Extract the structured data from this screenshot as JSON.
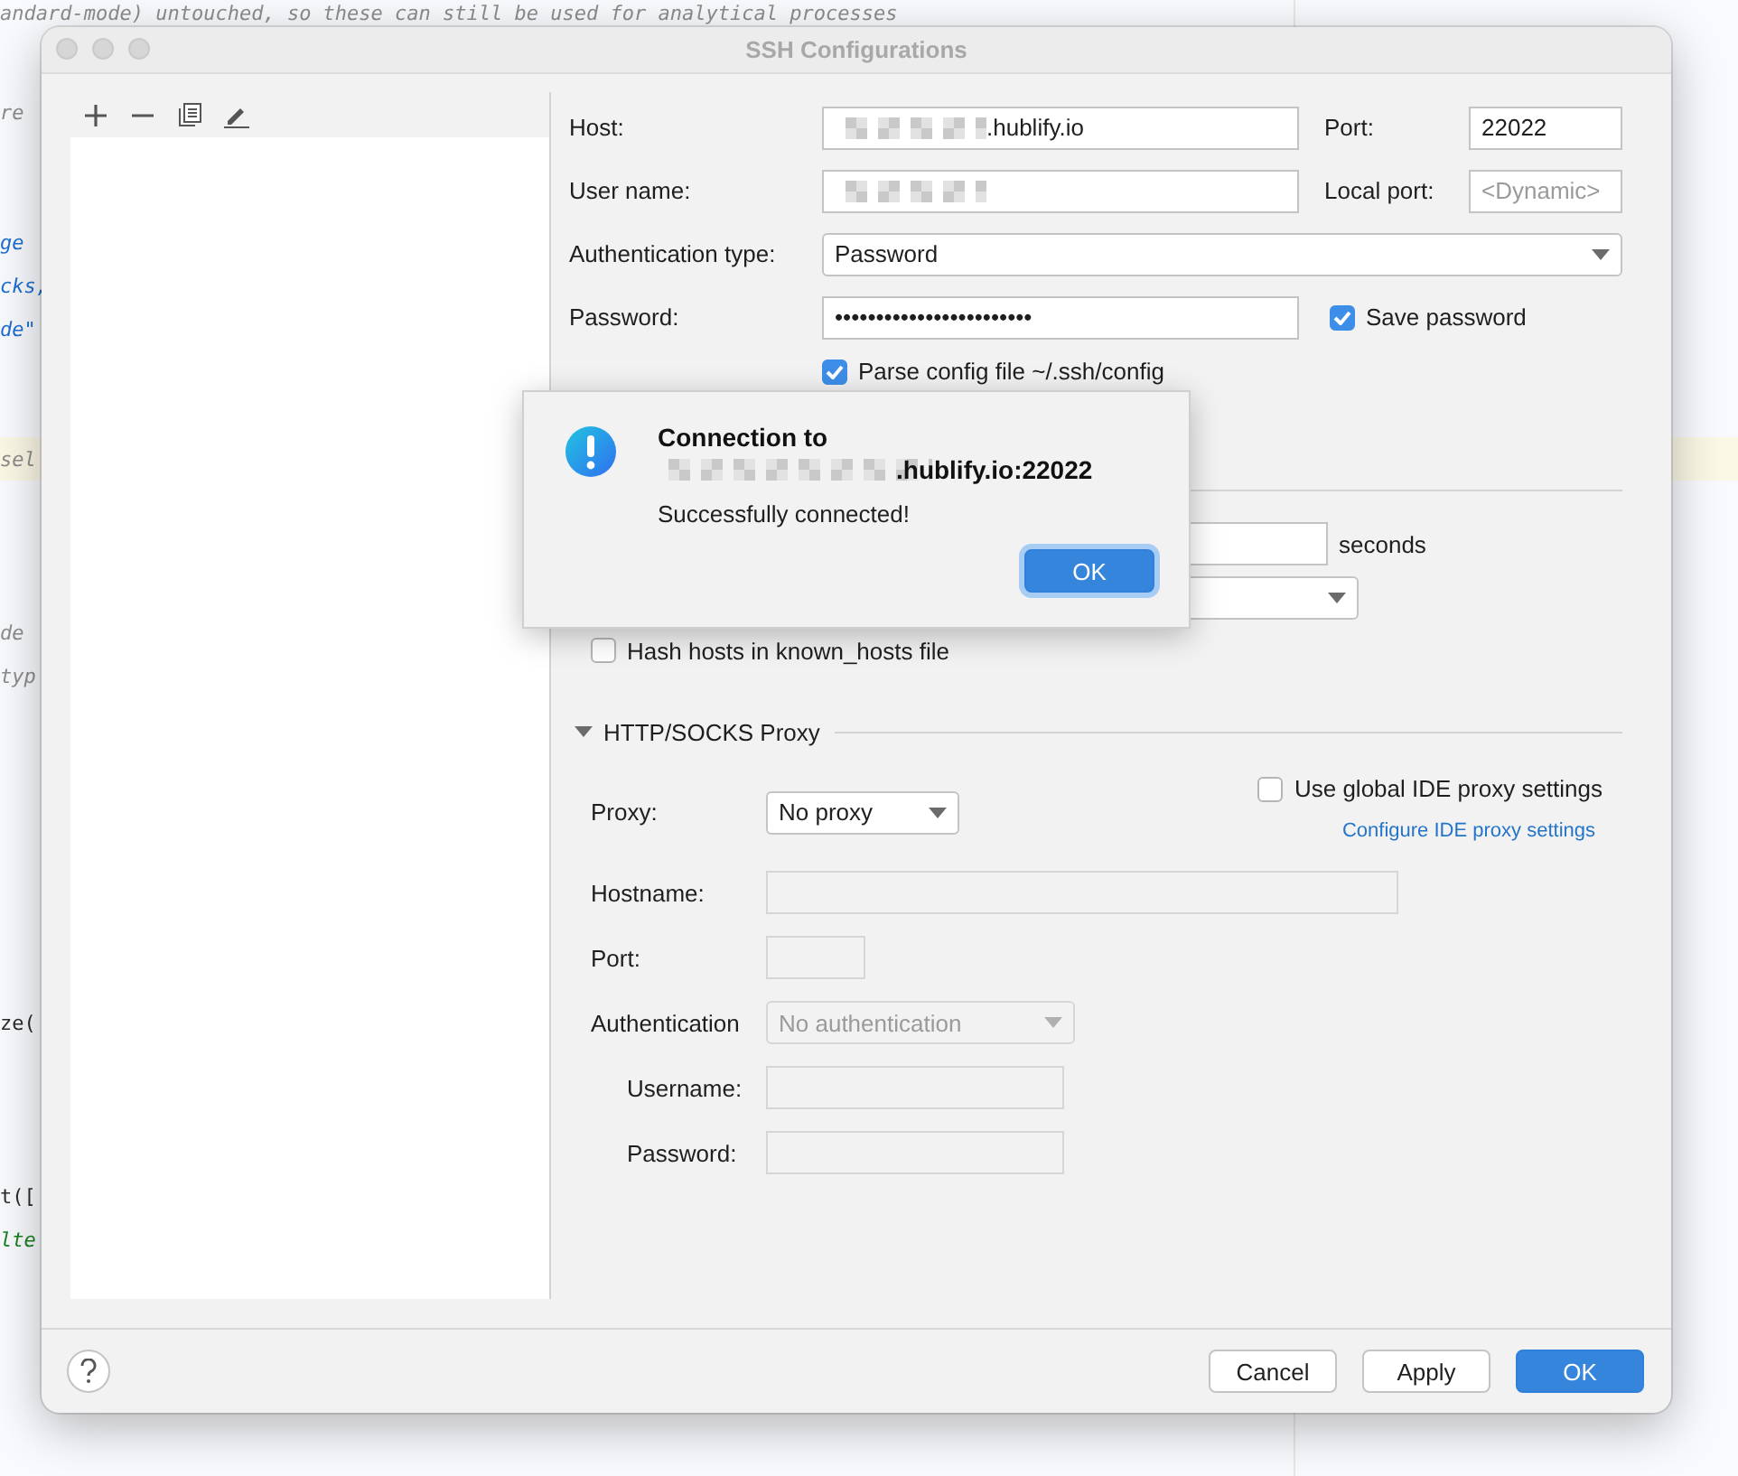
{
  "editor": {
    "lines": [
      {
        "text": "andard-mode) untouched, so these can still be used for analytical processes",
        "kind": "comment",
        "current": false
      },
      {
        "text": "re",
        "kind": "comment",
        "current": false
      },
      {
        "text": "ge",
        "kind": "keyword",
        "current": false
      },
      {
        "text": "cks,",
        "kind": "keyword",
        "current": false
      },
      {
        "text": "de\"",
        "kind": "keyword",
        "current": false
      },
      {
        "text": "sel",
        "kind": "comment",
        "current": true
      },
      {
        "text": "de",
        "kind": "comment",
        "current": false
      },
      {
        "text": "typ",
        "kind": "comment",
        "current": false
      },
      {
        "text": "ze(",
        "kind": "plain",
        "current": false
      },
      {
        "text": "t([",
        "kind": "plain",
        "current": false
      },
      {
        "text": "lte",
        "kind": "string",
        "current": false
      }
    ]
  },
  "dialog": {
    "title": "SSH Configurations",
    "form": {
      "host": {
        "label": "Host:",
        "value": ".hublify.io",
        "redacted": true
      },
      "port": {
        "label": "Port:",
        "value": "22022"
      },
      "user": {
        "label": "User name:",
        "redacted": true
      },
      "local_port": {
        "label": "Local port:",
        "placeholder": "<Dynamic>"
      },
      "auth_type": {
        "label": "Authentication type:",
        "value": "Password"
      },
      "password": {
        "label": "Password:",
        "value": "••••••••••••••••••••••••"
      },
      "save_password": {
        "label": "Save password",
        "checked": true
      },
      "parse_config": {
        "label": "Parse config file ~/.ssh/config",
        "checked": true
      },
      "seconds_unit": "seconds",
      "hash_hosts": {
        "label": "Hash hosts in known_hosts file",
        "checked": false
      }
    },
    "proxy": {
      "title": "HTTP/SOCKS Proxy",
      "expanded": true,
      "proxy": {
        "label": "Proxy:",
        "value": "No proxy"
      },
      "use_global": {
        "label": "Use global IDE proxy settings",
        "checked": false
      },
      "configure_link": "Configure IDE proxy settings",
      "hostname": {
        "label": "Hostname:"
      },
      "port": {
        "label": "Port:"
      },
      "authentication": {
        "label": "Authentication",
        "value": "No authentication",
        "disabled": true
      },
      "username": {
        "label": "Username:"
      },
      "password": {
        "label": "Password:"
      }
    },
    "buttons": [
      {
        "label": "Cancel",
        "primary": false
      },
      {
        "label": "Apply",
        "primary": false
      },
      {
        "label": "OK",
        "primary": true
      }
    ]
  },
  "alert": {
    "title": "Connection to",
    "host": ".hublify.io:22022",
    "host_redacted": true,
    "message": "Successfully connected!",
    "button": "OK"
  }
}
